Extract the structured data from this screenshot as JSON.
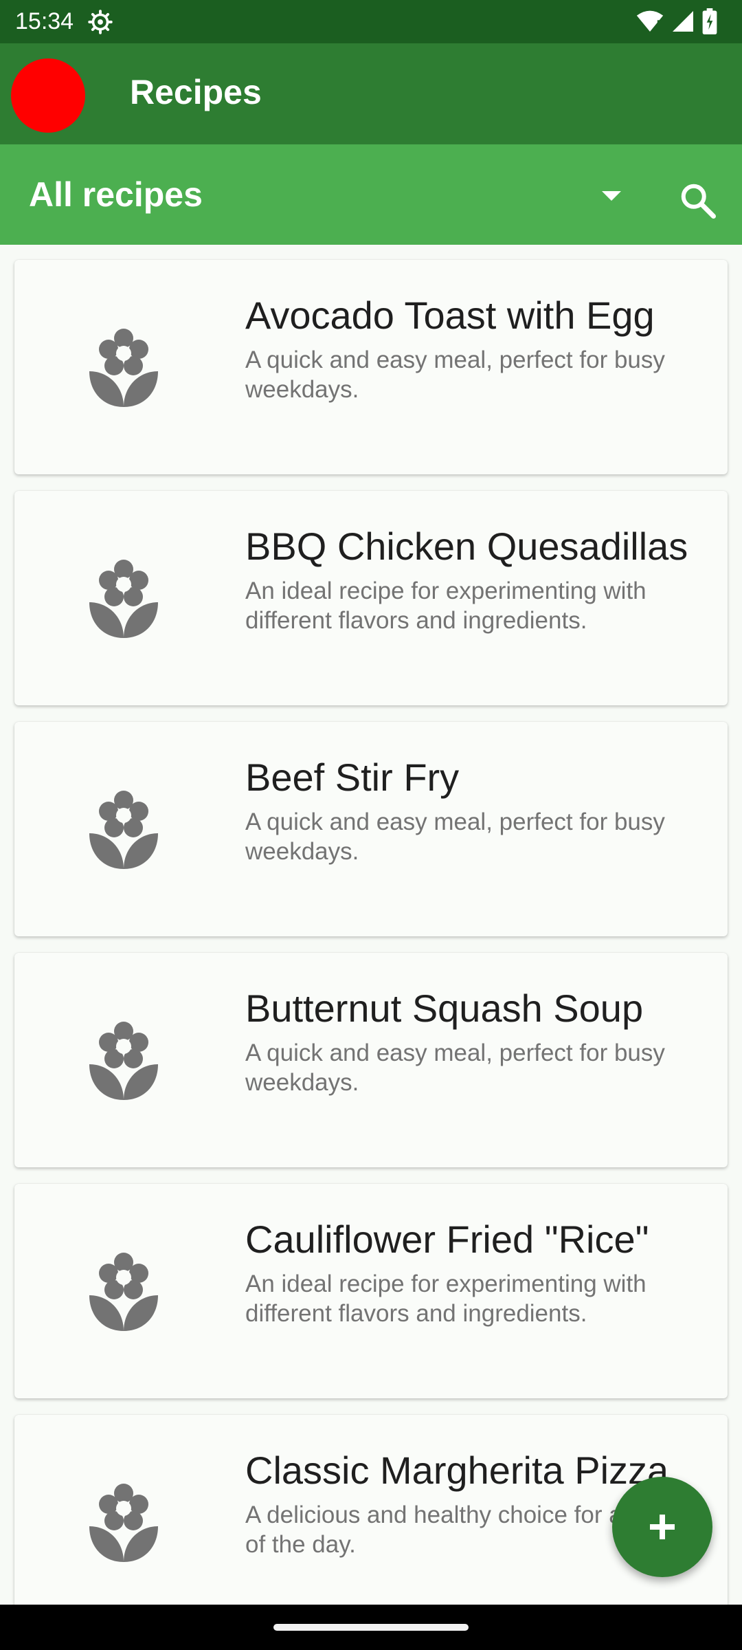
{
  "status_bar": {
    "time": "15:34",
    "icons": [
      "settings-icon",
      "wifi-icon",
      "signal-icon",
      "battery-icon"
    ]
  },
  "app_bar": {
    "title": "Recipes",
    "avatar_color": "#ff0000"
  },
  "filter": {
    "selected": "All recipes",
    "icons": [
      "dropdown-caret-icon",
      "search-icon"
    ]
  },
  "recipes": [
    {
      "title": "Avocado Toast with Egg",
      "description": "A quick and easy meal, perfect for busy weekdays."
    },
    {
      "title": "BBQ Chicken Quesadillas",
      "description": "An ideal recipe for experimenting with different flavors and ingredients."
    },
    {
      "title": "Beef Stir Fry",
      "description": "A quick and easy meal, perfect for busy weekdays."
    },
    {
      "title": "Butternut Squash Soup",
      "description": "A quick and easy meal, perfect for busy weekdays."
    },
    {
      "title": "Cauliflower Fried \"Rice\"",
      "description": "An ideal recipe for experimenting with different flavors and ingredients."
    },
    {
      "title": "Classic Margherita Pizza",
      "description": "A delicious and healthy choice for any time of the day."
    }
  ],
  "fab": {
    "icon": "add-icon"
  },
  "colors": {
    "primary_dark": "#1b5e20",
    "primary": "#2e7d32",
    "accent": "#4caf50",
    "icon_gray": "#737373"
  }
}
